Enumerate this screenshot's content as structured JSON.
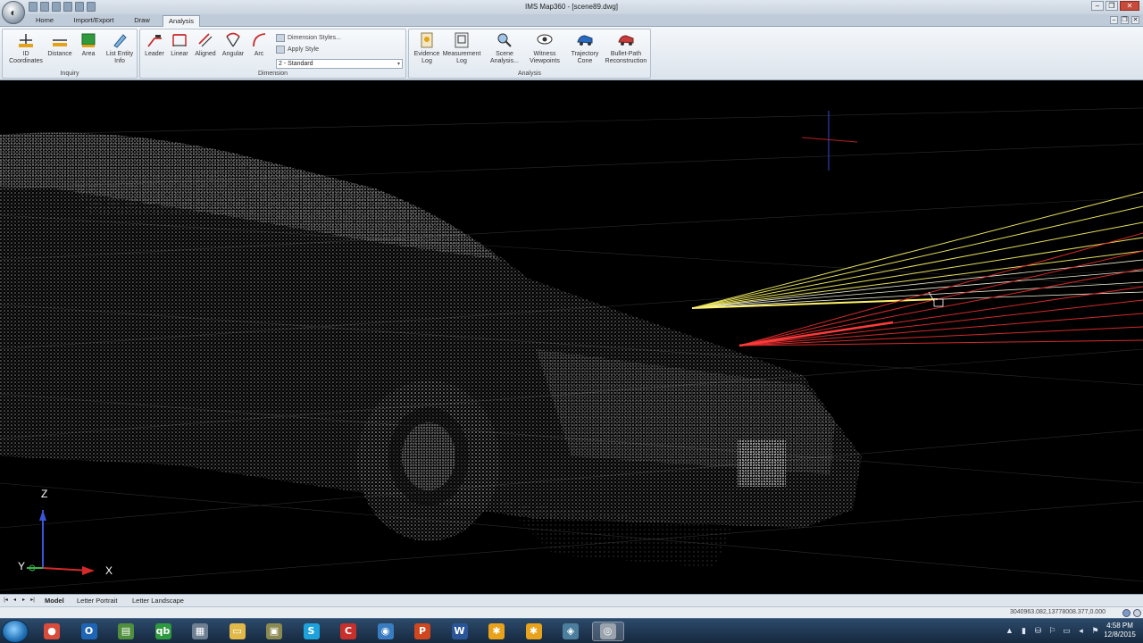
{
  "window": {
    "title": "IMS Map360  - [scene89.dwg]",
    "minimize": "–",
    "restore": "❐",
    "close": "✕"
  },
  "ribbon_tabs": [
    {
      "label": "Home"
    },
    {
      "label": "Import/Export"
    },
    {
      "label": "Draw"
    },
    {
      "label": "Analysis",
      "active": true
    }
  ],
  "groups": {
    "inquiry": {
      "label": "Inquiry",
      "buttons": [
        {
          "line1": "ID",
          "line2": "Coordinates",
          "icon": "id-coordinates-icon"
        },
        {
          "line1": "Distance",
          "line2": "",
          "icon": "distance-icon"
        },
        {
          "line1": "Area",
          "line2": "",
          "icon": "area-icon"
        },
        {
          "line1": "List Entity",
          "line2": "Info",
          "icon": "list-entity-icon"
        }
      ]
    },
    "dimension": {
      "label": "Dimension",
      "buttons": [
        {
          "line1": "Leader",
          "icon": "leader-icon"
        },
        {
          "line1": "Linear",
          "icon": "linear-icon"
        },
        {
          "line1": "Aligned",
          "icon": "aligned-icon"
        },
        {
          "line1": "Angular",
          "icon": "angular-icon"
        },
        {
          "line1": "Arc",
          "icon": "arc-icon"
        }
      ],
      "dimension_styles": "Dimension Styles...",
      "apply_style": "Apply Style",
      "style_value": "2 - Standard"
    },
    "analysis": {
      "label": "Analysis",
      "buttons": [
        {
          "line1": "Evidence",
          "line2": "Log",
          "icon": "evidence-log-icon"
        },
        {
          "line1": "Measurement",
          "line2": "Log",
          "icon": "measurement-log-icon"
        },
        {
          "line1": "Scene",
          "line2": "Analysis...",
          "icon": "scene-analysis-icon"
        },
        {
          "line1": "Witness",
          "line2": "Viewpoints",
          "icon": "witness-viewpoints-icon"
        },
        {
          "line1": "Trajectory",
          "line2": "Cone",
          "icon": "trajectory-cone-icon"
        },
        {
          "line1": "Bullet-Path",
          "line2": "Reconstruction",
          "icon": "bullet-path-icon"
        }
      ]
    }
  },
  "viewport": {
    "ucs_z": "Z",
    "ucs_y": "Y",
    "ucs_x": "X"
  },
  "layout_tabs": [
    {
      "label": "Model",
      "active": true
    },
    {
      "label": "Letter Portrait"
    },
    {
      "label": "Letter Landscape"
    }
  ],
  "status": {
    "coordinates": "3040963.082,13778008.377,0.000"
  },
  "taskbar": {
    "apps": [
      {
        "name": "chrome",
        "glyph": "●",
        "color": "#d94b3b"
      },
      {
        "name": "outlook",
        "glyph": "O",
        "color": "#1e66b5"
      },
      {
        "name": "notepad-app",
        "glyph": "▤",
        "color": "#4f8f3d"
      },
      {
        "name": "quickbooks",
        "glyph": "qb",
        "color": "#2d9a3f"
      },
      {
        "name": "calculator",
        "glyph": "▦",
        "color": "#6e7f92"
      },
      {
        "name": "explorer",
        "glyph": "▭",
        "color": "#e0b948"
      },
      {
        "name": "archive-app",
        "glyph": "▣",
        "color": "#8a8a52"
      },
      {
        "name": "skype",
        "glyph": "S",
        "color": "#1ea2dc"
      },
      {
        "name": "ccleaner",
        "glyph": "C",
        "color": "#c9302c"
      },
      {
        "name": "network-app",
        "glyph": "◉",
        "color": "#3a7cc1"
      },
      {
        "name": "powerpoint",
        "glyph": "P",
        "color": "#d0461f"
      },
      {
        "name": "word",
        "glyph": "W",
        "color": "#2a5699"
      },
      {
        "name": "map360-a",
        "glyph": "✱",
        "color": "#e9a21b"
      },
      {
        "name": "map360-b",
        "glyph": "✱",
        "color": "#e9a21b"
      },
      {
        "name": "drafting-app",
        "glyph": "◈",
        "color": "#4c7f9e"
      },
      {
        "name": "map360-active",
        "glyph": "◎",
        "color": "#9aa3ad"
      }
    ],
    "tray": [
      "▲",
      "▮",
      "⛁",
      "⚐",
      "▭",
      "◂",
      "⚑"
    ],
    "time": "4:58 PM",
    "date": "12/8/2015"
  }
}
